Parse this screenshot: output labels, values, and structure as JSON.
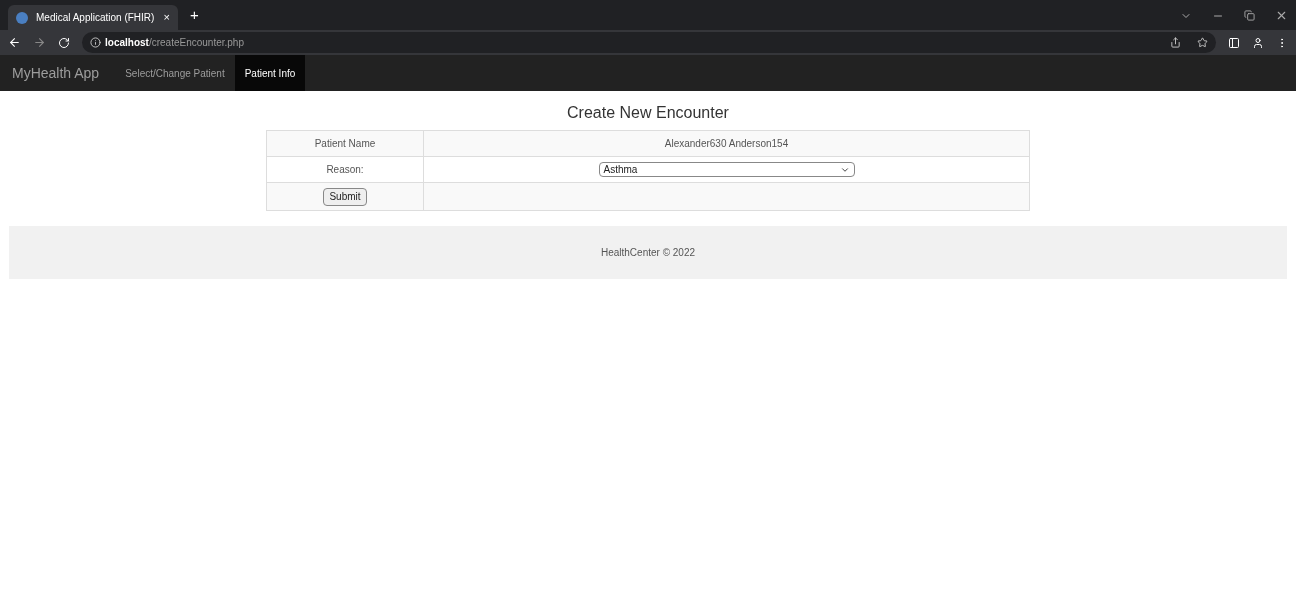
{
  "browser": {
    "tab_title": "Medical Application (FHIR)",
    "tab_close": "×",
    "new_tab": "+",
    "url_host": "localhost",
    "url_path": "/createEncounter.php"
  },
  "nav": {
    "brand": "MyHealth App",
    "items": [
      {
        "label": "Select/Change Patient",
        "selected": false
      },
      {
        "label": "Patient Info",
        "selected": true
      }
    ]
  },
  "form": {
    "title": "Create New Encounter",
    "patient_label": "Patient Name",
    "patient_value": "Alexander630 Anderson154",
    "reason_label": "Reason:",
    "reason_value": "Asthma",
    "submit": "Submit"
  },
  "footer": "HealthCenter © 2022"
}
